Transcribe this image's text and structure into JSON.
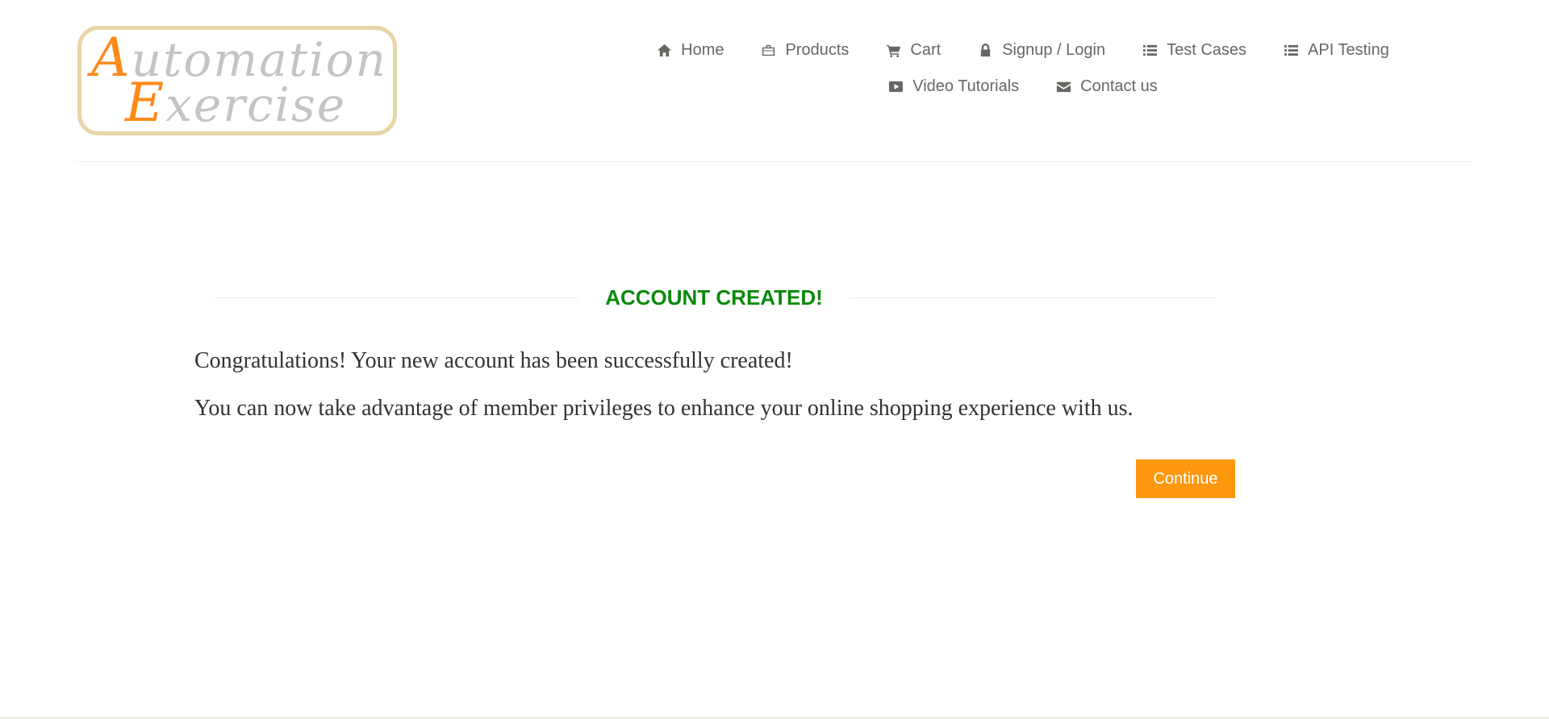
{
  "logo": {
    "line1_cap": "A",
    "line1_rest": "utomation",
    "line2_cap": "E",
    "line2_rest": "xercise"
  },
  "nav": {
    "items": [
      {
        "label": "Home",
        "icon": "home-icon"
      },
      {
        "label": "Products",
        "icon": "briefcase-icon"
      },
      {
        "label": "Cart",
        "icon": "cart-icon"
      },
      {
        "label": "Signup / Login",
        "icon": "lock-icon"
      },
      {
        "label": "Test Cases",
        "icon": "list-icon"
      },
      {
        "label": "API Testing",
        "icon": "list-icon"
      },
      {
        "label": "Video Tutorials",
        "icon": "youtube-play-icon"
      },
      {
        "label": "Contact us",
        "icon": "envelope-icon"
      }
    ]
  },
  "main": {
    "title": "ACCOUNT CREATED!",
    "message1": "Congratulations! Your new account has been successfully created!",
    "message2": "You can now take advantage of member privileges to enhance your online shopping experience with us.",
    "continue_label": "Continue"
  },
  "colors": {
    "accent": "#fe980f",
    "success": "#0a8a0a",
    "nav_text": "#696763"
  }
}
